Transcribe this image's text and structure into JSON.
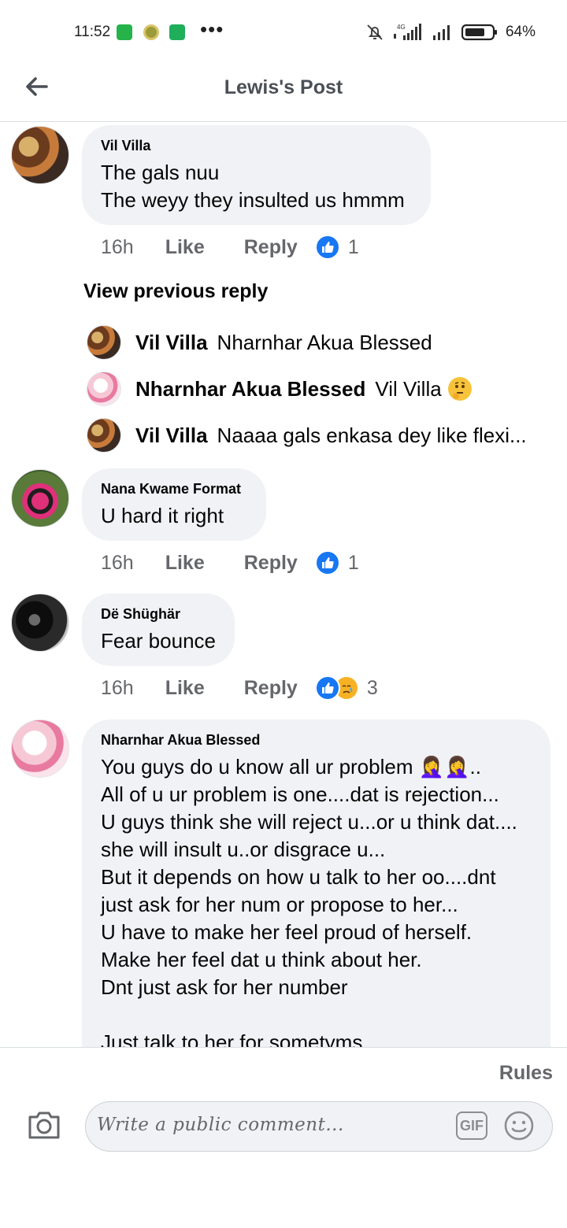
{
  "status_bar": {
    "time": "11:52",
    "more": "•••",
    "network": "4G",
    "battery": "64%"
  },
  "header": {
    "title": "Lewis's Post"
  },
  "comments": [
    {
      "author": "Vil Villa",
      "text": "The gals nuu\nThe weyy they insulted us hmmm",
      "time": "16h",
      "like_label": "Like",
      "reply_label": "Reply",
      "reactions": [
        "like"
      ],
      "reaction_count": "1"
    },
    {
      "author": "Nana Kwame Format",
      "text": "U hard it right",
      "time": "16h",
      "like_label": "Like",
      "reply_label": "Reply",
      "reactions": [
        "like"
      ],
      "reaction_count": "1"
    },
    {
      "author": "Dë Shüghär",
      "text": "Fear bounce",
      "time": "16h",
      "like_label": "Like",
      "reply_label": "Reply",
      "reactions": [
        "like",
        "sad"
      ],
      "reaction_count": "3"
    },
    {
      "author": "Nharnhar Akua Blessed",
      "text": "You guys do u know all ur problem 🤦‍♀️🤦‍♀️..\nAll of u ur problem is one....dat is rejection...\nU guys think she will reject u...or u think dat....\nshe will insult u..or disgrace u...\nBut it depends on how u talk to her oo....dnt\njust ask for her num or propose to her...\nU have to make her feel proud of herself.\nMake her feel dat u think about her.\nDnt just ask for her number\n\nJust talk to her for sometyms"
    }
  ],
  "view_previous_reply": "View previous reply",
  "replies": [
    {
      "author": "Vil Villa",
      "text": "Nharnhar Akua Blessed"
    },
    {
      "author": "Nharnhar Akua Blessed",
      "text": "Vil Villa"
    },
    {
      "author": "Vil Villa",
      "text": "Naaaa gals enkasa dey like flexi..."
    }
  ],
  "composer": {
    "rules": "Rules",
    "placeholder": "Write a public comment...",
    "gif_label": "GIF"
  },
  "icons": {
    "back": "back-arrow-icon",
    "camera": "camera-icon",
    "emoji": "emoji-icon",
    "like_reaction": "thumbs-up-icon",
    "sad_reaction": "crying-face-icon"
  },
  "colors": {
    "accent": "#1877f2",
    "bubble": "#f0f2f5",
    "secondary_text": "#65676b"
  }
}
